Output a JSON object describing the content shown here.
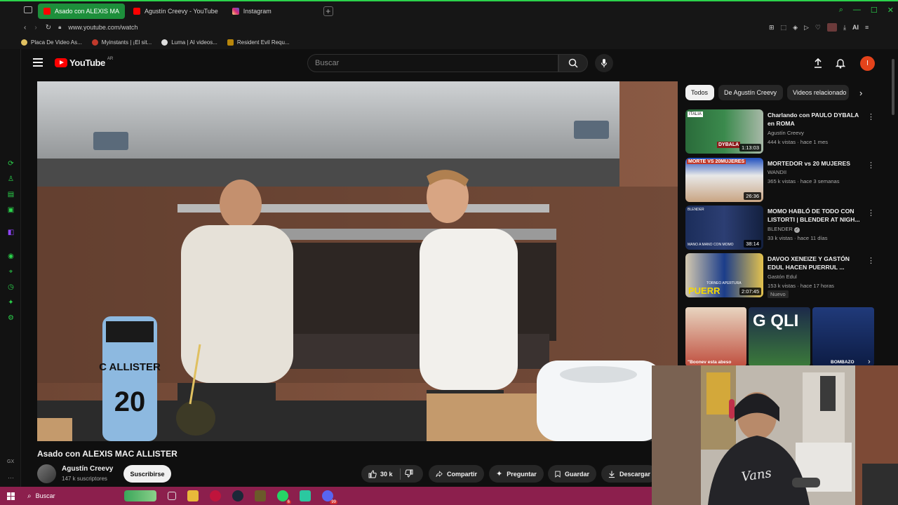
{
  "browser": {
    "tabs": [
      {
        "label": "Asado con ALEXIS MA",
        "icon": "youtube-icon",
        "active": true
      },
      {
        "label": "Agustín Creevy - YouTube",
        "icon": "youtube-icon",
        "active": false
      },
      {
        "label": "Instagram",
        "icon": "instagram-icon",
        "active": false
      }
    ],
    "url": "www.youtube.com/watch",
    "ai_label": "AI",
    "bookmarks": [
      {
        "label": "Placa De Video As...",
        "color": "#e0c060"
      },
      {
        "label": "Myinstants | ¡El sit...",
        "color": "#c0392b"
      },
      {
        "label": "Luma | AI videos...",
        "color": "#dddddd"
      },
      {
        "label": "Resident Evil Requ...",
        "color": "#b8860b"
      }
    ],
    "sidebar_bottom_label": "GX",
    "accent": "#2bd24b"
  },
  "youtube": {
    "logo_text": "YouTube",
    "logo_region": "AR",
    "search_placeholder": "Buscar",
    "avatar_letter": "I",
    "chips": [
      "Todos",
      "De Agustín Creevy",
      "Videos relacionado"
    ],
    "suggestions": [
      {
        "title": "Charlando con PAULO DYBALA en ROMA",
        "channel": "Agustín Creevy",
        "meta": "444 k vistas · hace 1 mes",
        "duration": "1:13:03",
        "thumb_text": "DYBALA",
        "corner_text": "ITALIA",
        "verified": false,
        "is_new": false
      },
      {
        "title": "MORTEDOR vs 20 MUJERES",
        "channel": "WANDII",
        "meta": "365 k vistas · hace 3 semanas",
        "duration": "26:36",
        "thumb_text": "MORTE VS 20MUJERES",
        "corner_text": "",
        "verified": false,
        "is_new": false
      },
      {
        "title": "MOMO HABLÓ DE TODO CON LISTORTI | BLENDER AT NIGH...",
        "channel": "BLENDER",
        "meta": "33 k vistas · hace 11 días",
        "duration": "38:14",
        "thumb_text": "MANO A MANO CON MOMO",
        "corner_text": "BLENDER",
        "verified": true,
        "is_new": false
      },
      {
        "title": "DAVOO XENEIZE Y GASTÓN EDUL HACEN PUERRUL ...",
        "channel": "Gastón Edul",
        "meta": "153 k vistas · hace 17 horas",
        "duration": "2:07:45",
        "thumb_text": "PUERR",
        "corner_text": "TORNEO APERTURA",
        "verified": false,
        "is_new": true,
        "new_label": "Nuevo"
      }
    ],
    "shorts_row": [
      {
        "caption": "\"Boonev esta abeso"
      },
      {
        "caption": "G QLI"
      },
      {
        "caption": "BOMBAZO"
      }
    ],
    "video": {
      "title": "Asado con ALEXIS MAC ALLISTER",
      "bottle_text": "C ALLISTER 20"
    },
    "channel": {
      "name": "Agustín Creevy",
      "subs": "147 k suscriptores",
      "subscribe_label": "Suscribirse"
    },
    "actions": {
      "likes": "30 k",
      "share": "Compartir",
      "ask": "Preguntar",
      "save": "Guardar",
      "download": "Descargar"
    }
  },
  "webcam": {
    "hoodie_text": "VANS"
  },
  "taskbar": {
    "search_label": "Buscar",
    "whatsapp_badge": "6",
    "discord_badge": "99"
  }
}
